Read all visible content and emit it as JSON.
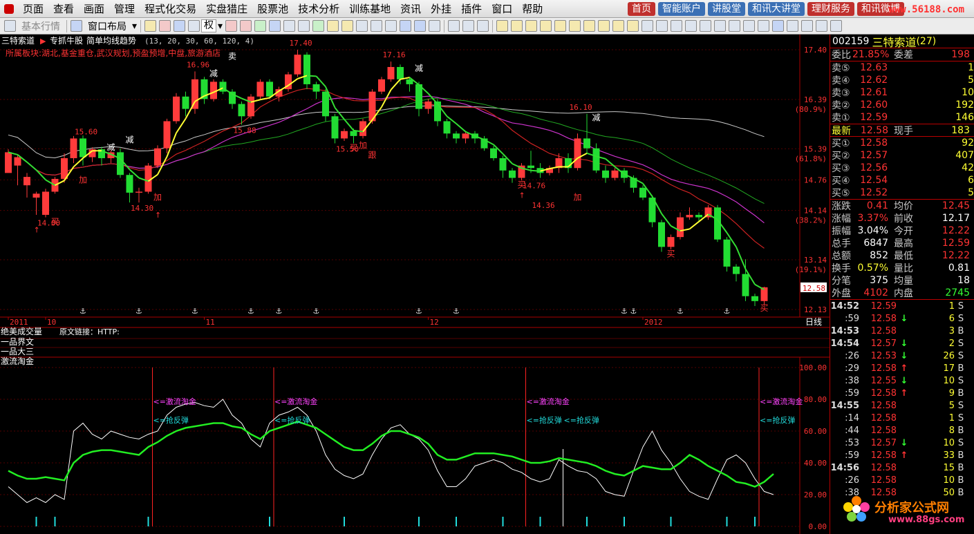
{
  "menu": {
    "items": [
      "页面",
      "查看",
      "画面",
      "管理",
      "程式化交易",
      "实盘猎庄",
      "股票池",
      "技术分析",
      "训练基地",
      "资讯",
      "外挂",
      "插件",
      "窗口",
      "帮助"
    ],
    "links": [
      {
        "label": "首页",
        "color": "#c0302d"
      },
      {
        "label": "智能账户",
        "color": "#3b70b5"
      },
      {
        "label": "讲股堂",
        "color": "#3b70b5"
      },
      {
        "label": "和讯大讲堂",
        "color": "#3b70b5"
      },
      {
        "label": "理财服务",
        "color": "#c0302d"
      },
      {
        "label": "和讯微博",
        "color": "#c0302d"
      }
    ],
    "watermark": "www.56188.com"
  },
  "toolbar": {
    "basic_quotes": "基本行情",
    "window_layout": "窗口布局",
    "quan_label": "权"
  },
  "chart_header": {
    "stock_name": "三特索道",
    "formula": "专抓牛股",
    "trend_title": "简单均线趋势",
    "params": "(13, 20, 30, 60, 120, 4)",
    "sector": "所属板块:湖北,基金重仓,武汉规划,预盈预增,中盘,旅游酒店"
  },
  "chart_data": {
    "type": "candlestick",
    "price_axis": {
      "labels": [
        "17.40",
        "16.39",
        "15.39",
        "14.76",
        "14.14",
        "13.14",
        "12.13"
      ],
      "pct_labels": [
        "(80.9%)",
        "(61.8%)",
        "(38.2%)",
        "(19.1%)"
      ],
      "current": "12.58"
    },
    "time_axis": {
      "labels": [
        "2011",
        "10",
        "11",
        "12",
        "2012"
      ],
      "period": "日线"
    },
    "candles": [
      [
        14.9,
        15.32,
        15.05,
        15.38
      ],
      [
        15.05,
        15.22,
        14.65,
        15.28
      ],
      [
        14.65,
        14.82,
        14.4,
        14.9
      ],
      [
        14.4,
        14.48,
        14.05,
        14.52
      ],
      [
        14.05,
        14.52,
        14.0,
        14.58
      ],
      [
        14.52,
        14.78,
        14.48,
        14.82
      ],
      [
        14.78,
        15.2,
        14.7,
        15.3
      ],
      [
        15.2,
        15.6,
        15.1,
        15.65
      ],
      [
        15.6,
        15.22,
        15.05,
        15.66
      ],
      [
        15.22,
        15.38,
        15.12,
        15.42
      ],
      [
        15.38,
        15.2,
        15.05,
        15.43
      ],
      [
        15.2,
        15.32,
        15.1,
        15.36
      ],
      [
        15.32,
        14.86,
        14.8,
        15.4
      ],
      [
        14.86,
        14.5,
        14.3,
        14.9
      ],
      [
        14.5,
        14.52,
        14.3,
        14.6
      ],
      [
        14.52,
        15.05,
        14.48,
        15.1
      ],
      [
        15.05,
        15.4,
        15.0,
        15.46
      ],
      [
        15.4,
        15.95,
        15.3,
        16.0
      ],
      [
        15.95,
        16.45,
        15.9,
        16.52
      ],
      [
        16.45,
        16.2,
        16.05,
        16.55
      ],
      [
        16.2,
        16.8,
        16.1,
        16.96
      ],
      [
        16.8,
        16.4,
        16.3,
        16.85
      ],
      [
        16.4,
        16.75,
        16.35,
        16.8
      ],
      [
        16.75,
        16.55,
        16.5,
        16.8
      ],
      [
        16.55,
        16.3,
        16.2,
        16.6
      ],
      [
        16.3,
        16.05,
        15.88,
        16.35
      ],
      [
        16.05,
        16.45,
        16.0,
        16.5
      ],
      [
        16.45,
        16.75,
        16.4,
        16.8
      ],
      [
        16.75,
        16.45,
        16.4,
        16.8
      ],
      [
        16.45,
        16.6,
        16.35,
        16.65
      ],
      [
        16.6,
        16.9,
        16.55,
        16.95
      ],
      [
        16.9,
        17.3,
        16.85,
        17.4
      ],
      [
        17.3,
        16.7,
        16.6,
        17.35
      ],
      [
        16.7,
        16.55,
        16.4,
        16.75
      ],
      [
        16.55,
        16.05,
        15.95,
        16.6
      ],
      [
        16.05,
        15.6,
        15.5,
        16.1
      ],
      [
        15.6,
        15.75,
        15.55,
        15.8
      ],
      [
        15.75,
        15.65,
        15.5,
        15.8
      ],
      [
        15.65,
        15.95,
        15.6,
        16.0
      ],
      [
        15.95,
        16.55,
        15.9,
        16.6
      ],
      [
        16.55,
        16.8,
        16.5,
        16.85
      ],
      [
        16.8,
        17.05,
        16.75,
        17.16
      ],
      [
        17.05,
        16.8,
        16.7,
        17.1
      ],
      [
        16.8,
        16.7,
        16.55,
        16.85
      ],
      [
        16.7,
        16.2,
        16.05,
        16.75
      ],
      [
        16.2,
        16.35,
        16.1,
        16.4
      ],
      [
        16.35,
        15.95,
        15.85,
        16.4
      ],
      [
        15.95,
        15.7,
        15.6,
        16.0
      ],
      [
        15.7,
        15.6,
        15.5,
        15.75
      ],
      [
        15.6,
        15.7,
        15.5,
        15.75
      ],
      [
        15.7,
        15.6,
        15.5,
        15.75
      ],
      [
        15.6,
        15.4,
        15.35,
        15.65
      ],
      [
        15.4,
        15.2,
        15.15,
        15.45
      ],
      [
        15.2,
        14.95,
        14.8,
        15.25
      ],
      [
        14.95,
        14.8,
        14.7,
        15.0
      ],
      [
        14.8,
        15.05,
        14.75,
        15.1
      ],
      [
        15.05,
        15.0,
        14.9,
        15.35
      ],
      [
        15.0,
        14.9,
        14.8,
        15.1
      ],
      [
        14.9,
        15.0,
        14.85,
        15.05
      ],
      [
        15.0,
        15.2,
        14.9,
        15.3
      ],
      [
        15.2,
        15.0,
        14.9,
        15.3
      ],
      [
        15.0,
        15.6,
        14.95,
        15.7
      ],
      [
        15.6,
        15.4,
        15.3,
        16.1
      ],
      [
        15.4,
        14.95,
        14.9,
        15.5
      ],
      [
        14.95,
        14.8,
        14.7,
        15.05
      ],
      [
        14.8,
        14.95,
        14.75,
        15.0
      ],
      [
        14.95,
        14.8,
        14.7,
        15.0
      ],
      [
        14.8,
        14.6,
        14.5,
        14.85
      ],
      [
        14.6,
        14.4,
        14.35,
        14.65
      ],
      [
        14.4,
        13.9,
        13.8,
        14.45
      ],
      [
        13.9,
        13.4,
        13.3,
        13.95
      ],
      [
        13.4,
        13.6,
        13.35,
        13.65
      ],
      [
        13.6,
        14.0,
        13.55,
        14.1
      ],
      [
        14.0,
        14.05,
        13.95,
        14.2
      ],
      [
        14.05,
        14.0,
        13.9,
        14.1
      ],
      [
        14.0,
        14.2,
        13.95,
        14.25
      ],
      [
        14.2,
        13.55,
        13.5,
        14.25
      ],
      [
        13.55,
        13.0,
        12.9,
        13.6
      ],
      [
        13.0,
        12.85,
        12.7,
        13.05
      ],
      [
        12.85,
        12.4,
        12.3,
        13.15
      ],
      [
        12.4,
        12.3,
        12.2,
        12.45
      ],
      [
        12.3,
        12.58,
        12.22,
        12.59
      ]
    ],
    "price_labels": [
      "17.40",
      "17.16",
      "16.96",
      "16.10",
      "15.88",
      "15.60",
      "15.50",
      "14.76",
      "14.36",
      "14.30",
      "14.00"
    ],
    "signal_labels": [
      "买",
      "卖",
      "减",
      "加",
      "跟"
    ],
    "indicator": {
      "name": "激流淘金",
      "sub_rows": [
        "绝美成交量",
        "原文链接：HTTP:",
        "一品界文",
        "一品大三"
      ],
      "axis": [
        "100.00",
        "80.00",
        "60.00",
        "40.00",
        "20.00",
        "0.00"
      ],
      "annotations": [
        "<=激流淘金",
        "<=抢反弹"
      ],
      "slow": [
        35,
        32,
        30,
        30,
        31,
        30,
        29,
        40,
        45,
        47,
        48,
        48,
        47,
        46,
        45,
        50,
        53,
        57,
        60,
        62,
        63,
        64,
        65,
        65,
        63,
        62,
        58,
        55,
        60,
        62,
        64,
        66,
        64,
        62,
        58,
        54,
        50,
        48,
        48,
        52,
        57,
        60,
        60,
        58,
        56,
        52,
        45,
        42,
        42,
        44,
        46,
        46,
        46,
        45,
        44,
        42,
        40,
        40,
        41,
        43,
        42,
        41,
        40,
        38,
        35,
        33,
        32,
        35,
        38,
        37,
        36,
        36,
        40,
        45,
        42,
        38,
        35,
        32,
        28,
        27,
        25,
        28,
        33
      ],
      "fast": [
        25,
        20,
        15,
        18,
        15,
        20,
        17,
        60,
        65,
        58,
        55,
        60,
        58,
        56,
        55,
        58,
        60,
        70,
        75,
        77,
        78,
        76,
        75,
        80,
        70,
        65,
        55,
        50,
        65,
        70,
        72,
        75,
        70,
        60,
        45,
        36,
        32,
        30,
        33,
        45,
        55,
        62,
        64,
        58,
        55,
        48,
        35,
        25,
        25,
        30,
        38,
        40,
        42,
        40,
        36,
        34,
        30,
        28,
        30,
        42,
        38,
        35,
        34,
        30,
        22,
        20,
        19,
        35,
        50,
        60,
        48,
        40,
        30,
        22,
        19,
        17,
        30,
        42,
        45,
        40,
        30,
        22,
        20
      ]
    }
  },
  "quote": {
    "code": "002159",
    "name": "三特索道",
    "count": "(27)",
    "weibi_label": "委比",
    "weibi": "21.85%",
    "weicha_label": "委差",
    "weicha": "198",
    "sell": [
      {
        "label": "卖⑤",
        "price": "12.63",
        "vol": "1"
      },
      {
        "label": "卖④",
        "price": "12.62",
        "vol": "5"
      },
      {
        "label": "卖③",
        "price": "12.61",
        "vol": "10"
      },
      {
        "label": "卖②",
        "price": "12.60",
        "vol": "192"
      },
      {
        "label": "卖①",
        "price": "12.59",
        "vol": "146"
      }
    ],
    "latest_label": "最新",
    "latest": "12.58",
    "xianshou_label": "现手",
    "xianshou": "183",
    "buy": [
      {
        "label": "买①",
        "price": "12.58",
        "vol": "92"
      },
      {
        "label": "买②",
        "price": "12.57",
        "vol": "407"
      },
      {
        "label": "买③",
        "price": "12.56",
        "vol": "42"
      },
      {
        "label": "买④",
        "price": "12.54",
        "vol": "6"
      },
      {
        "label": "买⑤",
        "price": "12.52",
        "vol": "5"
      }
    ],
    "stats": [
      {
        "l1": "涨跌",
        "v1": "0.41",
        "c1": "#ff3333",
        "l2": "均价",
        "v2": "12.45",
        "c2": "#ff3333"
      },
      {
        "l1": "涨幅",
        "v1": "3.37%",
        "c1": "#ff3333",
        "l2": "前收",
        "v2": "12.17",
        "c2": "#ffffff"
      },
      {
        "l1": "振幅",
        "v1": "3.04%",
        "c1": "#ffffff",
        "l2": "今开",
        "v2": "12.22",
        "c2": "#ff3333"
      },
      {
        "l1": "总手",
        "v1": "6847",
        "c1": "#ffffff",
        "l2": "最高",
        "v2": "12.59",
        "c2": "#ff3333"
      },
      {
        "l1": "总额",
        "v1": "852",
        "c1": "#ffffff",
        "l2": "最低",
        "v2": "12.22",
        "c2": "#ff3333"
      },
      {
        "l1": "换手",
        "v1": "0.57%",
        "c1": "#ffff33",
        "l2": "量比",
        "v2": "0.81",
        "c2": "#ffffff"
      },
      {
        "l1": "分笔",
        "v1": "375",
        "c1": "#ffffff",
        "l2": "均量",
        "v2": "18",
        "c2": "#ffffff"
      },
      {
        "l1": "外盘",
        "v1": "4102",
        "c1": "#ff3333",
        "l2": "内盘",
        "v2": "2745",
        "c2": "#33ff33"
      }
    ],
    "ticks": [
      {
        "time": "14:52",
        "price": "12.59",
        "arrow": "",
        "vol": "1",
        "bs": "S",
        "bold": true
      },
      {
        "time": ":59",
        "price": "12.58",
        "arrow": "↓",
        "vol": "6",
        "bs": "S",
        "bold": false
      },
      {
        "time": "14:53",
        "price": "12.58",
        "arrow": "",
        "vol": "3",
        "bs": "B",
        "bold": true
      },
      {
        "time": "14:54",
        "price": "12.57",
        "arrow": "↓",
        "vol": "2",
        "bs": "S",
        "bold": true
      },
      {
        "time": ":26",
        "price": "12.53",
        "arrow": "↓",
        "vol": "26",
        "bs": "S",
        "bold": false
      },
      {
        "time": ":29",
        "price": "12.58",
        "arrow": "↑",
        "vol": "17",
        "bs": "B",
        "bold": false
      },
      {
        "time": ":38",
        "price": "12.55",
        "arrow": "↓",
        "vol": "10",
        "bs": "S",
        "bold": false
      },
      {
        "time": ":59",
        "price": "12.58",
        "arrow": "↑",
        "vol": "9",
        "bs": "B",
        "bold": false
      },
      {
        "time": "14:55",
        "price": "12.58",
        "arrow": "",
        "vol": "5",
        "bs": "S",
        "bold": true
      },
      {
        "time": ":14",
        "price": "12.58",
        "arrow": "",
        "vol": "1",
        "bs": "S",
        "bold": false
      },
      {
        "time": ":44",
        "price": "12.58",
        "arrow": "",
        "vol": "8",
        "bs": "B",
        "bold": false
      },
      {
        "time": ":53",
        "price": "12.57",
        "arrow": "↓",
        "vol": "10",
        "bs": "S",
        "bold": false
      },
      {
        "time": ":59",
        "price": "12.58",
        "arrow": "↑",
        "vol": "33",
        "bs": "B",
        "bold": false
      },
      {
        "time": "14:56",
        "price": "12.58",
        "arrow": "",
        "vol": "15",
        "bs": "B",
        "bold": true
      },
      {
        "time": ":26",
        "price": "12.58",
        "arrow": "",
        "vol": "10",
        "bs": "B",
        "bold": false
      },
      {
        "time": ":38",
        "price": "12.58",
        "arrow": "",
        "vol": "50",
        "bs": "B",
        "bold": false
      }
    ]
  },
  "brand": {
    "title": "分析家公式网",
    "url": "www.88gs.com"
  },
  "colors": {
    "up": "#ff3b3b",
    "down": "#22dd33",
    "ma_yellow": "#ffff33",
    "ma_green": "#33dd33",
    "ma_red": "#cc2222",
    "ma_magenta": "#cc33cc",
    "ma_green2": "#22aa22",
    "ma_white": "#cccccc"
  }
}
